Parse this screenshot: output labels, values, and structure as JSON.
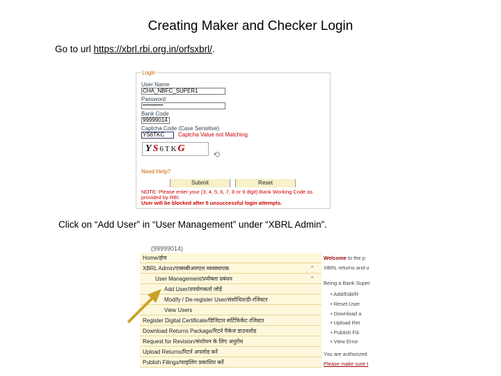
{
  "title": "Creating Maker and Checker Login",
  "step1": {
    "prefix": "Go to url ",
    "link": "https://xbrl.rbi.org.in/orfsxbrl/",
    "suffix": "."
  },
  "step2": "Click on “Add User” in “User Management” under “XBRL Admin”.",
  "login": {
    "legend": "Login",
    "username_label": "User Name",
    "username_value": "CHA_NBFC_SUPER1",
    "password_label": "Password",
    "password_value": "••••••••••••••",
    "bankcode_label": "Bank Code",
    "bankcode_value": "99999014",
    "captcha_label": "Captcha Code (Case Sensitive)",
    "captcha_value": "YS6TKC",
    "captcha_error": "Captcha Value not Matching",
    "captcha_text_a": "Y",
    "captcha_text_b": "S",
    "captcha_text_c": "6TK",
    "captcha_text_d": "G",
    "need_help": "Need Help?",
    "submit": "Submit",
    "reset": "Reset",
    "note1": "NOTE: Please enter your (3, 4, 5, 6, 7, 8 or 9 digit) Bank Working Code as provided by RBI.",
    "note2": "User will be blocked after 5 unsuccessful login attempts."
  },
  "menu": {
    "account": "(99999014)",
    "items": [
      "Home/होम",
      "XBRL Admin/एक्सबीआरएल व्यवस्थापक",
      "User Management/प्रयोक्ता प्रबंधन",
      "Add User/उपयोगकर्ता जोड़ें",
      "Modify / De-register User/संशोधित/डी-रजिस्टर",
      "View Users",
      "Register Digital Certificate/डिजिटल सर्टिफिकेट रजिस्टर",
      "Download Returns Package/रिटर्न पैकेज डाउनलोड",
      "Request for Revision/संशोधन के लिए अनुरोध",
      "Upload Returns/रिटर्न अपलोड करें",
      "Publish Filings/फाइलिंग प्रकाशित करें"
    ]
  },
  "right": {
    "welcome": "Welcome",
    "welcome_rest": " to the p",
    "line1": "XBRL returns and u",
    "line2": "Being a Bank Super",
    "bullets": [
      "Add/Edit/R",
      "Reset User",
      "Download a",
      "Upload Ret",
      "Publish Fili",
      "View Error"
    ],
    "line3": "You are authorized",
    "line4": "Please make sure t"
  },
  "colors": {
    "arrow": "#c9a227",
    "menu_bg": "#fdf7dc",
    "error": "#cc0000"
  }
}
